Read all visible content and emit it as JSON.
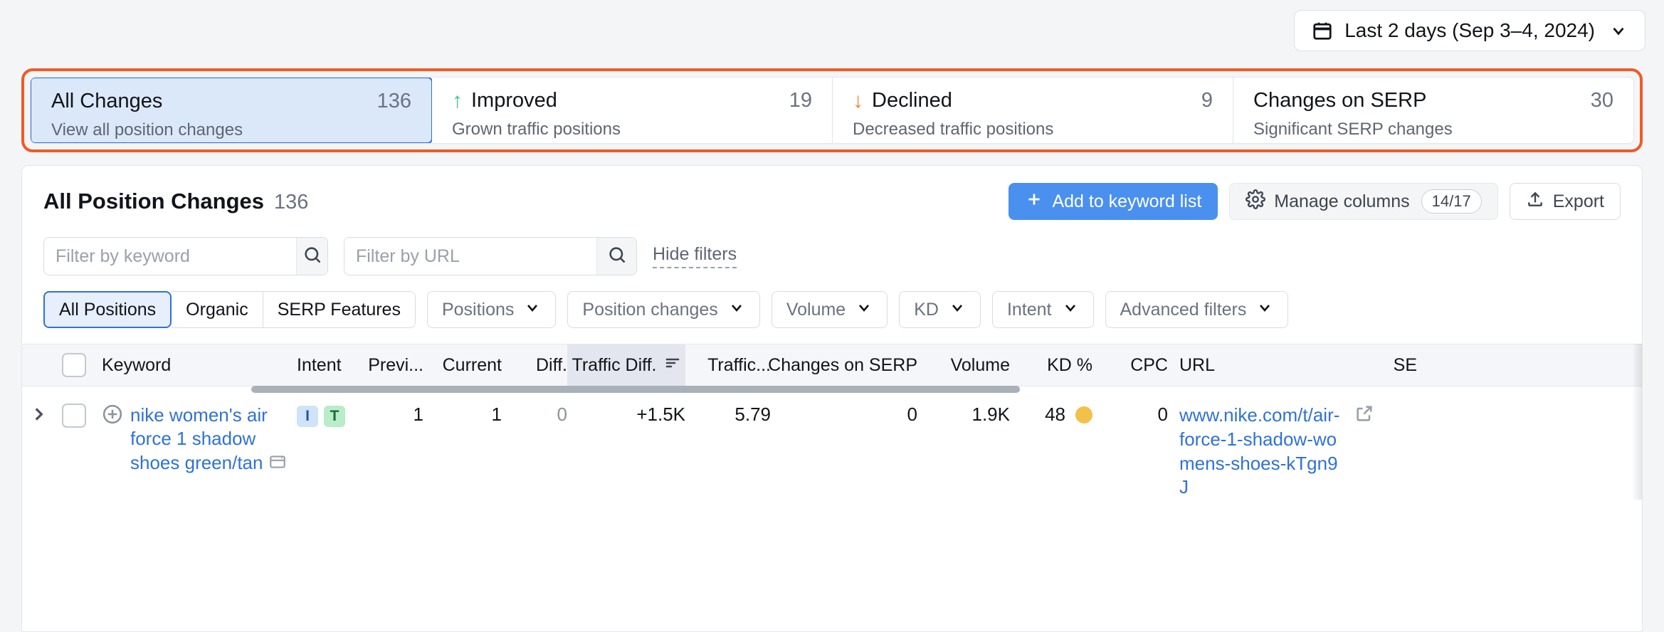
{
  "date_picker": {
    "label": "Last 2 days (Sep 3–4, 2024)",
    "icon": "calendar-icon",
    "chevron": "chevron-down-icon"
  },
  "summary_cards": [
    {
      "title": "All Changes",
      "count": "136",
      "subtitle": "View all position changes",
      "arrow": "",
      "active": true
    },
    {
      "title": "Improved",
      "count": "19",
      "subtitle": "Grown traffic positions",
      "arrow": "↑",
      "active": false
    },
    {
      "title": "Declined",
      "count": "9",
      "subtitle": "Decreased traffic positions",
      "arrow": "↓",
      "active": false
    },
    {
      "title": "Changes on SERP",
      "count": "30",
      "subtitle": "Significant SERP changes",
      "arrow": "",
      "active": false
    }
  ],
  "panel": {
    "title": "All Position Changes",
    "count": "136",
    "actions": {
      "add_to_list": "Add to keyword list",
      "manage_columns": "Manage columns",
      "manage_columns_count": "14/17",
      "export": "Export"
    }
  },
  "filters": {
    "keyword_placeholder": "Filter by keyword",
    "keyword_value": "",
    "url_placeholder": "Filter by URL",
    "url_value": "",
    "hide_filters": "Hide filters",
    "segments": [
      {
        "label": "All Positions",
        "active": true
      },
      {
        "label": "Organic",
        "active": false
      },
      {
        "label": "SERP Features",
        "active": false
      }
    ],
    "dropdowns": [
      "Positions",
      "Position changes",
      "Volume",
      "KD",
      "Intent",
      "Advanced filters"
    ]
  },
  "table": {
    "columns": [
      "Keyword",
      "Intent",
      "Previ...",
      "Current",
      "Diff.",
      "Traffic Diff.",
      "Traffic...",
      "Changes on SERP",
      "Volume",
      "KD %",
      "CPC",
      "URL",
      "SE"
    ],
    "sorted_column": "Traffic Diff.",
    "rows": [
      {
        "keyword": "nike women's air force 1 shadow shoes green/tan",
        "intent": [
          {
            "letter": "I",
            "type": "informational"
          },
          {
            "letter": "T",
            "type": "transactional"
          }
        ],
        "previous": "1",
        "current": "1",
        "diff": "0",
        "traffic_diff": "+1.5K",
        "traffic": "5.79",
        "changes_on_serp": "0",
        "volume": "1.9K",
        "kd": "48",
        "kd_color": "#f3c14b",
        "cpc": "0",
        "url": "www.nike.com/t/air-force-1-shadow-womens-shoes-kTgn9J"
      }
    ]
  },
  "colors": {
    "accent_blue": "#4a90ee",
    "selected_border": "#2f72d6",
    "selected_bg": "#dbe8f9",
    "highlight_ring": "#f05a28",
    "improved_green": "#3dc58b",
    "declined_orange": "#f2812f",
    "kd_amber": "#f3c14b",
    "link_blue": "#2f72d6"
  }
}
